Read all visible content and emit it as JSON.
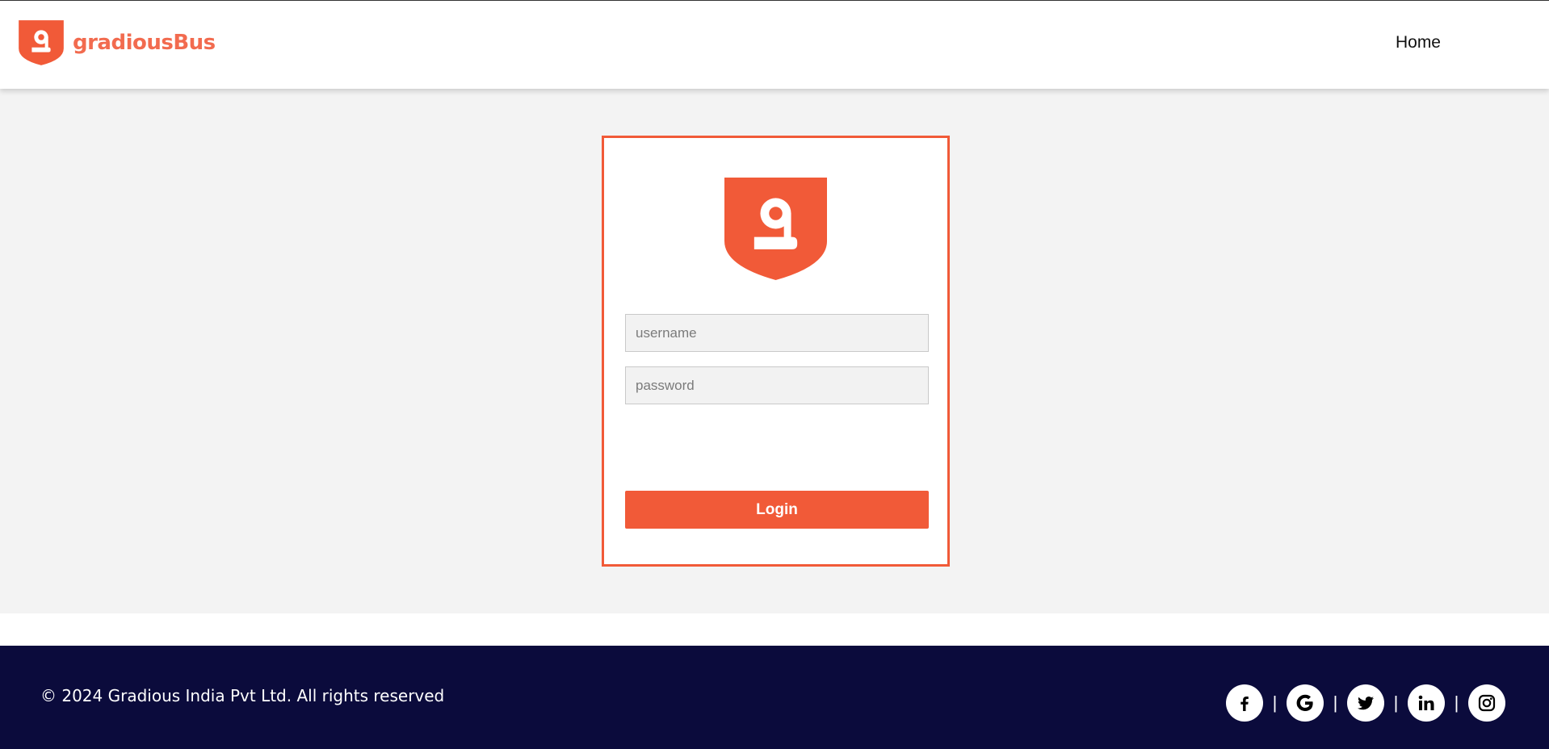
{
  "colors": {
    "brand": "#f15a38",
    "footer_bg": "#0b0b3c",
    "page_bg": "#f3f3f3"
  },
  "header": {
    "brand_name": "gradiousBus",
    "logo_icon": "gradious-shield-logo",
    "nav": {
      "home_label": "Home"
    }
  },
  "login": {
    "logo_icon": "gradious-shield-logo",
    "username": {
      "placeholder": "username",
      "value": ""
    },
    "password": {
      "placeholder": "password",
      "value": ""
    },
    "submit_label": "Login"
  },
  "footer": {
    "copyright": "© 2024 Gradious India Pvt Ltd. All rights reserved",
    "separator": "|",
    "socials": [
      {
        "icon": "facebook-icon"
      },
      {
        "icon": "google-icon"
      },
      {
        "icon": "twitter-icon"
      },
      {
        "icon": "linkedin-icon"
      },
      {
        "icon": "instagram-icon"
      }
    ]
  }
}
